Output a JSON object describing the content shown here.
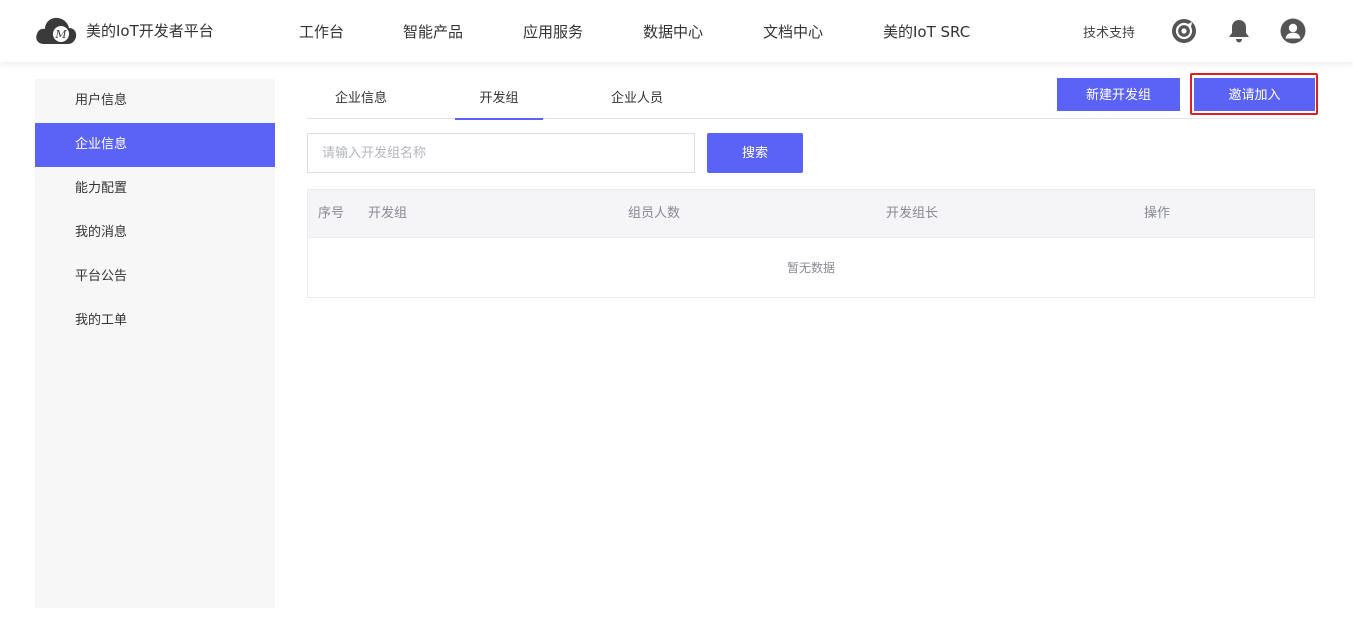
{
  "header": {
    "logo_text": "美的IoT开发者平台",
    "nav": [
      "工作台",
      "智能产品",
      "应用服务",
      "数据中心",
      "文档中心",
      "美的IoT SRC"
    ],
    "support": "技术支持",
    "icons": [
      "target-icon",
      "bell-icon",
      "user-avatar-icon"
    ]
  },
  "sidebar": {
    "items": [
      {
        "label": "用户信息",
        "active": false
      },
      {
        "label": "企业信息",
        "active": true
      },
      {
        "label": "能力配置",
        "active": false
      },
      {
        "label": "我的消息",
        "active": false
      },
      {
        "label": "平台公告",
        "active": false
      },
      {
        "label": "我的工单",
        "active": false
      }
    ]
  },
  "tabs": [
    {
      "label": "企业信息",
      "active": false
    },
    {
      "label": "开发组",
      "active": true
    },
    {
      "label": "企业人员",
      "active": false
    }
  ],
  "actions": {
    "new_group": "新建开发组",
    "invite": "邀请加入"
  },
  "search": {
    "placeholder": "请输入开发组名称",
    "value": "",
    "button": "搜索"
  },
  "table": {
    "columns": [
      "序号",
      "开发组",
      "组员人数",
      "开发组长",
      "操作"
    ],
    "rows": [],
    "empty_text": "暂无数据"
  },
  "colors": {
    "accent": "#5b63f6",
    "highlight": "#e02020",
    "sidebar_bg": "#f7f7f8"
  }
}
